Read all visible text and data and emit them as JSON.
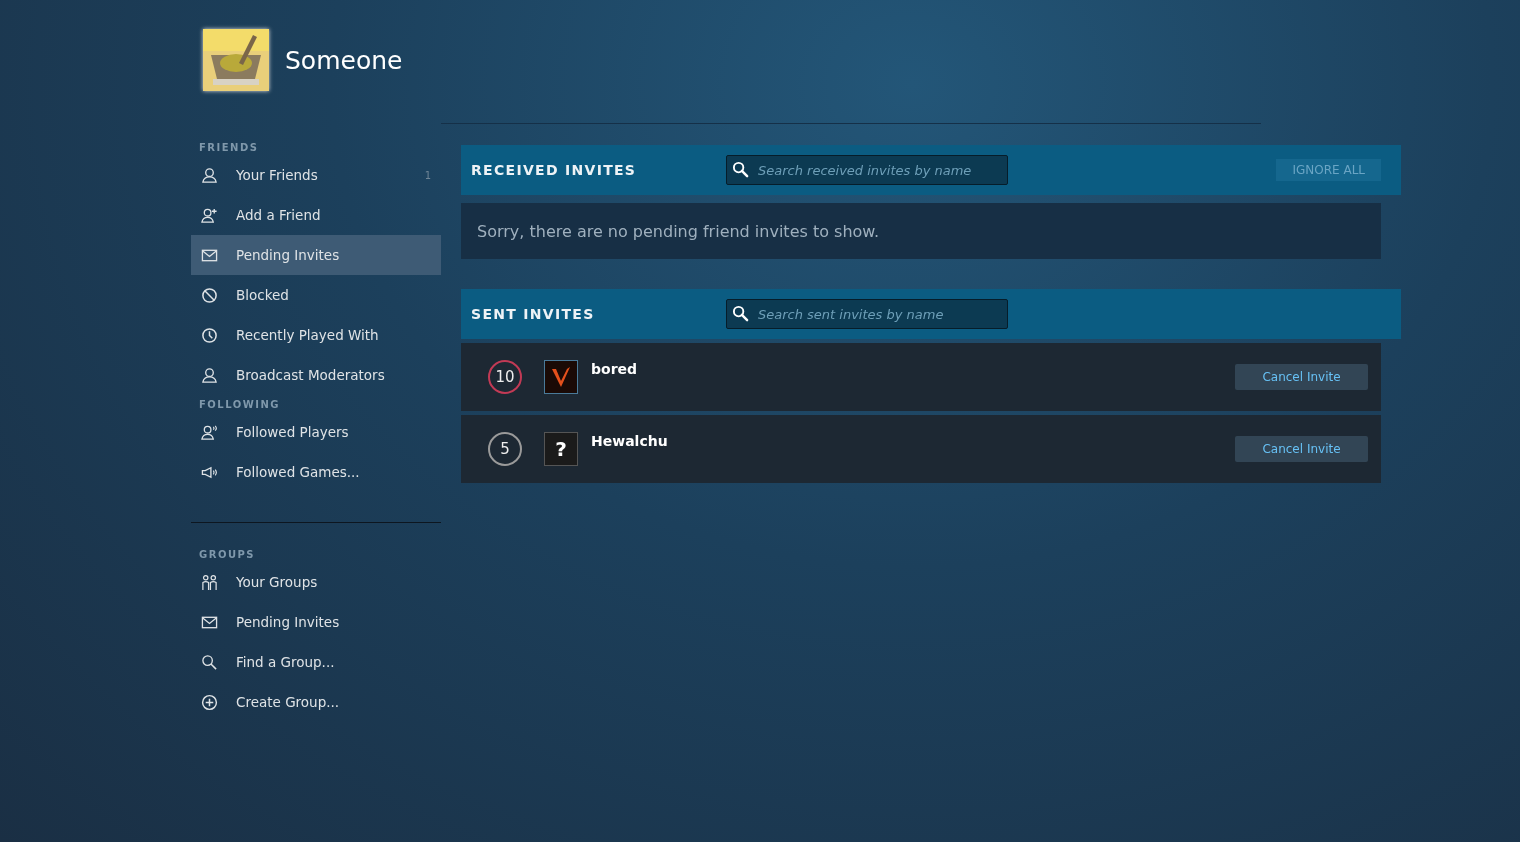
{
  "profile": {
    "name": "Someone"
  },
  "sidebar": {
    "sections": [
      {
        "heading": "FRIENDS",
        "items": [
          {
            "label": "Your Friends",
            "kind": "person",
            "count": "1",
            "selected": false
          },
          {
            "label": "Add a Friend",
            "kind": "person-add",
            "selected": false
          },
          {
            "label": "Pending Invites",
            "kind": "envelope",
            "selected": true
          },
          {
            "label": "Blocked",
            "kind": "blocked",
            "selected": false
          },
          {
            "label": "Recently Played With",
            "kind": "clock",
            "selected": false
          },
          {
            "label": "Broadcast Moderators",
            "kind": "person",
            "selected": false
          }
        ]
      },
      {
        "heading": "FOLLOWING",
        "items": [
          {
            "label": "Followed Players",
            "kind": "person-sound",
            "selected": false
          },
          {
            "label": "Followed Games...",
            "kind": "megaphone",
            "selected": false
          }
        ]
      },
      {
        "heading": "GROUPS",
        "items": [
          {
            "label": "Your Groups",
            "kind": "group",
            "selected": false
          },
          {
            "label": "Pending Invites",
            "kind": "envelope",
            "selected": false
          },
          {
            "label": "Find a Group...",
            "kind": "search",
            "selected": false
          },
          {
            "label": "Create Group...",
            "kind": "plus",
            "selected": false
          }
        ]
      }
    ]
  },
  "received": {
    "title": "RECEIVED INVITES",
    "search": {
      "placeholder": "Search received invites by name"
    },
    "ignore_all": "IGNORE ALL",
    "empty_message": "Sorry, there are no pending friend invites to show."
  },
  "sent": {
    "title": "SENT INVITES",
    "search": {
      "placeholder": "Search sent invites by name"
    },
    "rows": [
      {
        "level_badge": "10",
        "color": "#c23a55",
        "avatar": {
          "kind": "image"
        },
        "name": "bored",
        "action": "Cancel Invite"
      },
      {
        "level_badge": "5",
        "color": "#9a9a9a",
        "avatar": {
          "kind": "unknown",
          "glyph": "?"
        },
        "name": "Hewalchu",
        "action": "Cancel Invite"
      }
    ]
  }
}
